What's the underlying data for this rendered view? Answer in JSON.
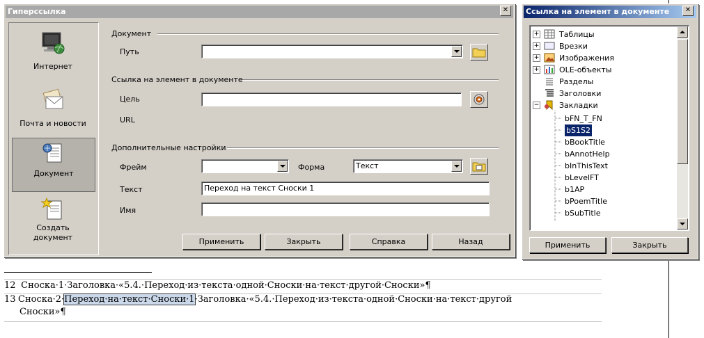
{
  "document": {
    "footnotes": [
      {
        "num": "12",
        "text": "Сноска·1·Заголовка·«5.4.·Переход·из·текста·одной·Сноски·на·текст·другой·Сноски»¶"
      },
      {
        "num": "13",
        "pre": "Сноска·2·",
        "selected": "Переход·на·текст·Сноски·1",
        "post": "·Заголовка·«5.4.·Переход·из·текста·одной·Сноски·на·текст·другой",
        "line2": "Сноски»¶"
      }
    ]
  },
  "hyperlink_dialog": {
    "title": "Гиперссылка",
    "categories": [
      {
        "label": "Интернет",
        "icon": "globe-computer-icon",
        "active": false
      },
      {
        "label": "Почта и новости",
        "icon": "envelope-icon",
        "active": false
      },
      {
        "label": "Документ",
        "icon": "document-icon",
        "active": true
      },
      {
        "label_line1": "Создать",
        "label_line2": "документ",
        "icon": "new-document-icon",
        "active": false
      }
    ],
    "document_group": {
      "title": "Документ",
      "path_label": "Путь",
      "path_value": ""
    },
    "target_group": {
      "title": "Ссылка на элемент в документе",
      "target_label": "Цель",
      "target_value": "",
      "url_label": "URL",
      "url_value": ""
    },
    "additional_group": {
      "title": "Дополнительные настройки",
      "frame_label": "Фрейм",
      "frame_value": "",
      "form_label": "Форма",
      "form_value": "Текст",
      "text_label": "Текст",
      "text_value": "Переход на текст Сноски 1",
      "name_label": "Имя",
      "name_value": ""
    },
    "buttons": {
      "apply": "Применить",
      "close": "Закрыть",
      "help": "Справка",
      "back": "Назад"
    }
  },
  "navigator": {
    "title": "Ссылка на элемент в документе",
    "tree": [
      {
        "label": "Таблицы",
        "expander": "+",
        "icon": "table-icon"
      },
      {
        "label": "Врезки",
        "expander": "+",
        "icon": "frame-icon"
      },
      {
        "label": "Изображения",
        "expander": "+",
        "icon": "image-icon"
      },
      {
        "label": "OLE-объекты",
        "expander": "+",
        "icon": "ole-object-icon"
      },
      {
        "label": "Разделы",
        "expander": "",
        "icon": "sections-icon"
      },
      {
        "label": "Заголовки",
        "expander": "",
        "icon": "headings-icon"
      },
      {
        "label": "Закладки",
        "expander": "−",
        "icon": "bookmark-icon"
      }
    ],
    "bookmarks": [
      "bFN_T_FN",
      "bS1S2",
      "bBookTitle",
      "bAnnotHelp",
      "bInThisText",
      "bLevelFT",
      "b1AP",
      "bPoemTitle",
      "bSubTitle"
    ],
    "selected_bookmark": "bS1S2",
    "buttons": {
      "apply": "Применить",
      "close": "Закрыть"
    }
  }
}
